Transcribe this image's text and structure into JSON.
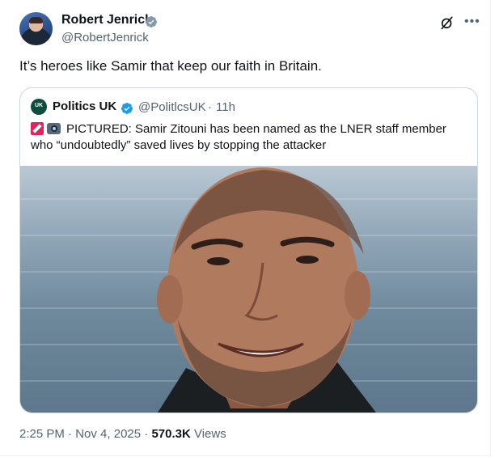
{
  "author": {
    "name": "Robert Jenrick",
    "handle": "@RobertJenrick"
  },
  "tweet": {
    "text": "It’s heroes like Samir that keep our faith in Britain."
  },
  "quote": {
    "avatar_label": "UK",
    "name": "Politics UK",
    "handle": "@PolitlcsUK",
    "separator": "·",
    "time": "11h",
    "text": "PICTURED: Samir Zitouni has been named as the LNER staff member who “undoubtedly” saved lives by stopping the attacker"
  },
  "meta": {
    "time": "2:25 PM",
    "dot1": " · ",
    "date": "Nov 4, 2025",
    "dot2": " · ",
    "views_count": "570.3K",
    "views_label": " Views"
  },
  "icons": {
    "verified": "verified-badge-icon",
    "grok": "grok-icon",
    "more": "more-icon"
  },
  "colors": {
    "verified_blue": "#1d9bf0",
    "secondary_text": "#536471",
    "primary_text": "#0f1419",
    "border": "#cfd9de"
  }
}
